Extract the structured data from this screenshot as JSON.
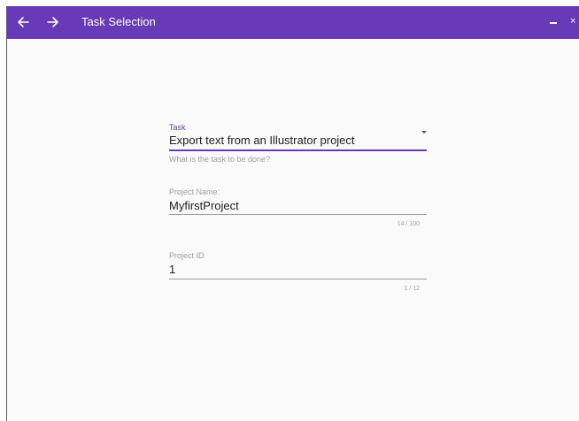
{
  "window": {
    "title": "Task Selection",
    "close_glyph": "×"
  },
  "form": {
    "task": {
      "label": "Task",
      "value": "Export text from an Illustrator project",
      "hint": "What is the task to be done?"
    },
    "project_name": {
      "label": "Project Name:",
      "value": "MyfirstProject",
      "counter": "14 / 100"
    },
    "project_id": {
      "label": "Project ID",
      "value": "1",
      "counter": "1 / 12"
    }
  },
  "icons": {
    "back": "arrow-left-icon",
    "forward": "arrow-right-icon",
    "minimize": "minimize-icon",
    "close": "close-icon",
    "dropdown": "caret-down-icon"
  },
  "colors": {
    "accent": "#673ab7",
    "background": "#fafafa",
    "text": "#212121",
    "muted": "#9e9e9e"
  }
}
